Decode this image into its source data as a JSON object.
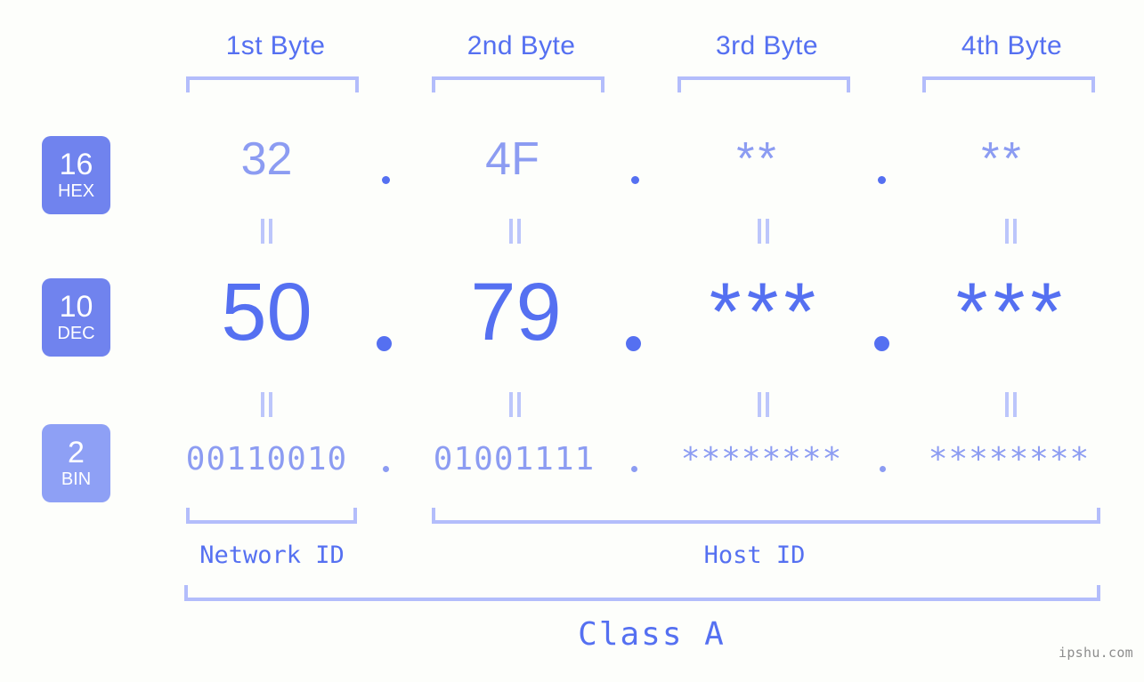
{
  "background_color": "#fdfefb",
  "accent_color": "#5570f1",
  "accent_light_color": "#8c9cf2",
  "bracket_color": "#b3bdfb",
  "byte_headers": [
    {
      "label": "1st Byte"
    },
    {
      "label": "2nd Byte"
    },
    {
      "label": "3rd Byte"
    },
    {
      "label": "4th Byte"
    }
  ],
  "rows": [
    {
      "base": "16",
      "base_name": "HEX",
      "badge_color": "#7083ee",
      "values": [
        "32",
        "4F",
        "**",
        "**"
      ]
    },
    {
      "base": "10",
      "base_name": "DEC",
      "badge_color": "#7083ee",
      "values": [
        "50",
        "79",
        "***",
        "***"
      ]
    },
    {
      "base": "2",
      "base_name": "BIN",
      "badge_color": "#8ea0f5",
      "values": [
        "00110010",
        "01001111",
        "********",
        "********"
      ]
    }
  ],
  "separator": ".",
  "segments": {
    "network_id": "Network ID",
    "host_id": "Host ID"
  },
  "class_label": "Class A",
  "watermark": "ipshu.com"
}
